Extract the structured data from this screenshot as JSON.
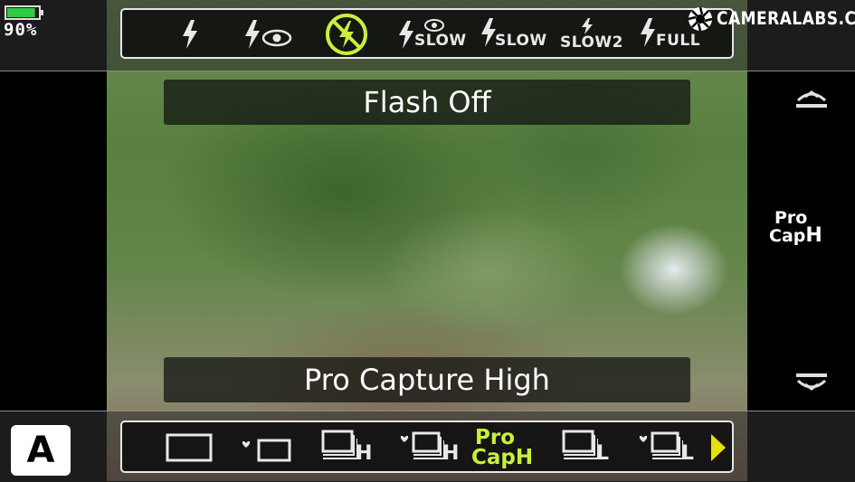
{
  "status": {
    "battery_percent_label": "90%",
    "battery_level": 0.9,
    "battery_color": "#2ecc40"
  },
  "logo": {
    "text": "CAMERALABS.COM",
    "icon": "aperture-logo-icon"
  },
  "flash_menu": {
    "items": [
      {
        "icon": "flash-auto-icon",
        "label": ""
      },
      {
        "icon": "flash-redeye-icon",
        "label": ""
      },
      {
        "icon": "flash-off-icon",
        "label": "",
        "selected": true
      },
      {
        "icon": "flash-redeye-slow-icon",
        "label": "SLOW"
      },
      {
        "icon": "flash-slow-icon",
        "label": "SLOW"
      },
      {
        "icon": "flash-slow2-icon",
        "label": "SLOW2"
      },
      {
        "icon": "flash-full-icon",
        "label": "FULL"
      }
    ],
    "selected_label": "Flash Off",
    "accent_color": "#c8f03c"
  },
  "drive_menu": {
    "selected_label": "Pro Capture High",
    "items": [
      {
        "icon": "single-shot-icon",
        "label": ""
      },
      {
        "icon": "single-silent-icon",
        "label": ""
      },
      {
        "icon": "sequential-high-icon",
        "label": "H"
      },
      {
        "icon": "sequential-silent-high-icon",
        "label": "H"
      },
      {
        "icon": "pro-capture-high-icon",
        "label_top": "Pro",
        "label_bottom": "Cap",
        "label_suffix": "H",
        "selected": true
      },
      {
        "icon": "sequential-low-icon",
        "label": "L"
      },
      {
        "icon": "sequential-silent-low-icon",
        "label": "L"
      }
    ],
    "more_arrow_color": "#e8e000"
  },
  "side_panel": {
    "procap_top": "Pro",
    "procap_bottom": "Cap",
    "procap_suffix": "H"
  },
  "mode": {
    "label": "A"
  }
}
